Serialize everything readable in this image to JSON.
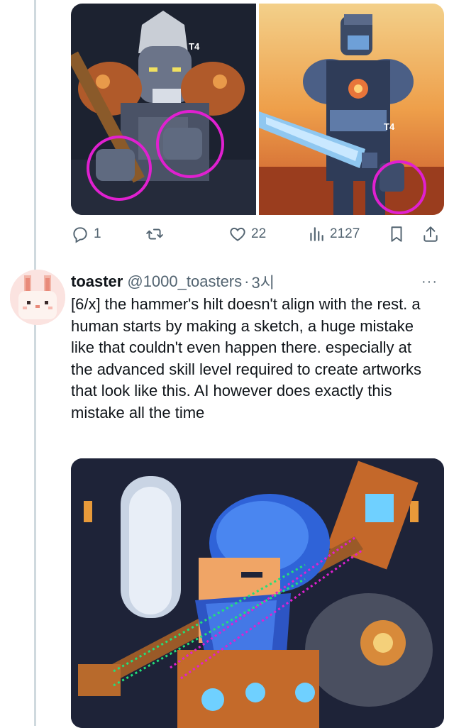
{
  "thread": {
    "top_actions": {
      "replies": "1",
      "likes": "22",
      "views": "2127"
    },
    "media_watermark": "T4"
  },
  "tweet": {
    "display_name": "toaster",
    "handle": "@1000_toasters",
    "separator": "·",
    "time": "3시",
    "more_label": "···",
    "text": "[6/x] the hammer's hilt doesn't align with the rest. a human starts by making a sketch, a huge mistake like that couldn't even happen there. especially at the advanced skill level required to create artworks that look like this. AI however does exactly this mistake all the time"
  },
  "icons": [
    "reply-icon",
    "retweet-icon",
    "like-icon",
    "views-icon",
    "bookmark-icon",
    "share-icon",
    "more-icon"
  ],
  "colors": {
    "annotation_circle": "#e020d0",
    "annotation_line_green": "#22e07a",
    "annotation_line_magenta": "#e020d0",
    "text_secondary": "#536471"
  }
}
